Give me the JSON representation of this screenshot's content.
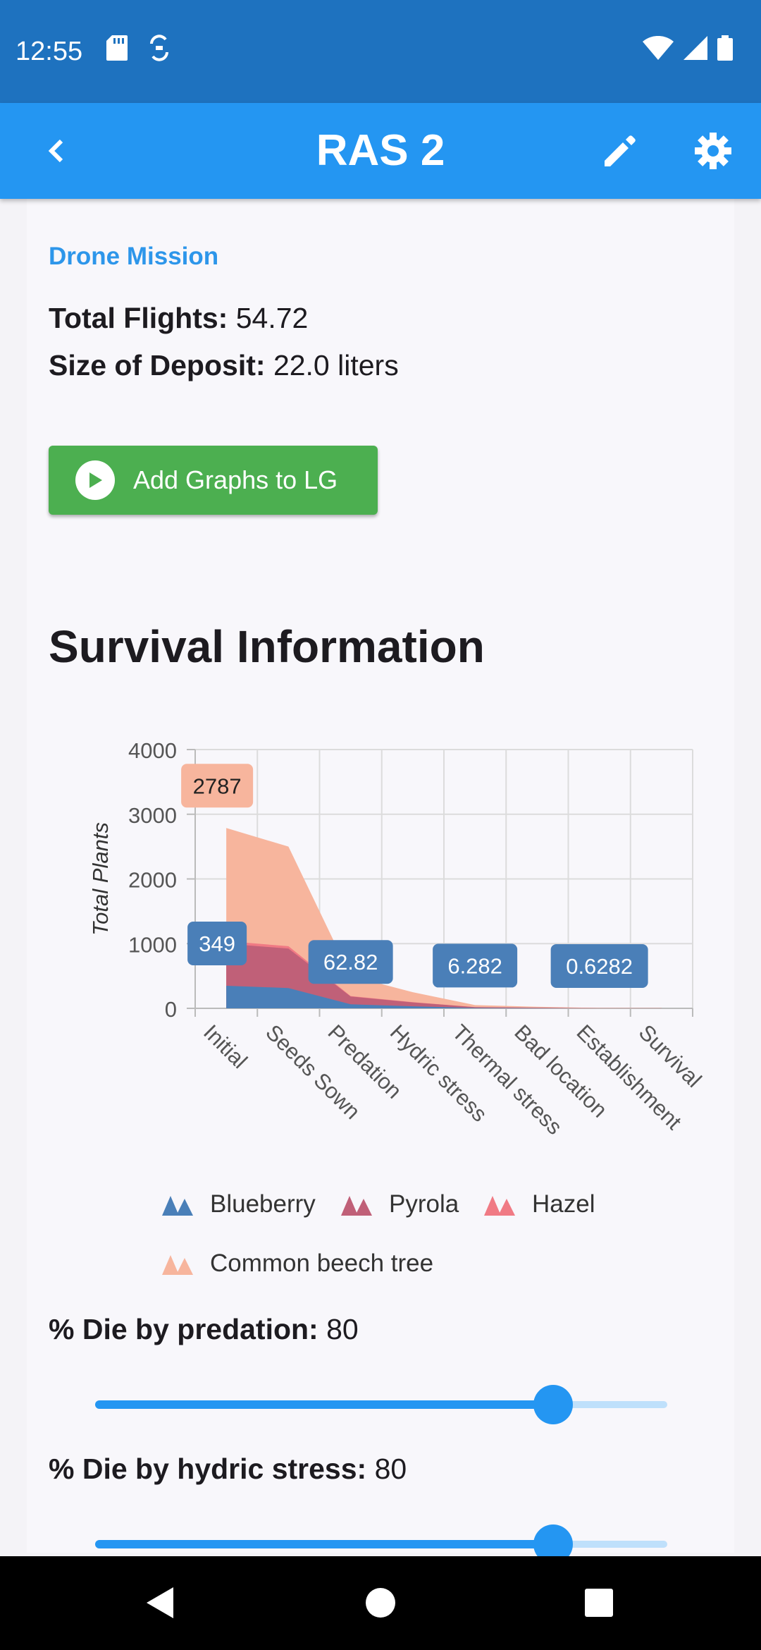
{
  "status_bar": {
    "time": "12:55",
    "icons": [
      "sd-card-icon",
      "sync-icon",
      "wifi-icon",
      "signal-icon",
      "battery-icon"
    ]
  },
  "app_bar": {
    "title": "RAS 2",
    "icons": [
      "back-chevron-icon",
      "pencil-icon",
      "gear-icon"
    ]
  },
  "drone_mission": {
    "section_label": "Drone Mission",
    "total_flights_label": "Total Flights:",
    "total_flights_value": "54.72",
    "deposit_label": "Size of Deposit:",
    "deposit_value": "22.0 liters"
  },
  "add_graphs_button": {
    "label": "Add Graphs to LG",
    "icon": "play-circle-icon"
  },
  "survival": {
    "heading": "Survival Information"
  },
  "chart_data": {
    "type": "area",
    "stacked": true,
    "ylabel": "Total Plants",
    "xlabel": "",
    "ylim": [
      0,
      4000
    ],
    "yticks": [
      "4000",
      "3000",
      "2000",
      "1000",
      "0"
    ],
    "categories": [
      "Initial",
      "Seeds Sown",
      "Predation",
      "Hydric stress",
      "Thermal stress",
      "Bad location",
      "Establishment",
      "Survival"
    ],
    "grid": true,
    "series": [
      {
        "name": "Blueberry",
        "color": "#4a7fb8",
        "values": [
          349,
          314,
          62.82,
          31.4,
          6.282,
          3.1,
          0.6282,
          0.3
        ]
      },
      {
        "name": "Pyrola",
        "color": "#c06078",
        "values": [
          650,
          610,
          120,
          60,
          12,
          6,
          1.2,
          0.6
        ]
      },
      {
        "name": "Hazel",
        "color": "#f07a84",
        "values": [
          40,
          36,
          7,
          3.5,
          0.7,
          0.35,
          0.07,
          0.04
        ]
      },
      {
        "name": "Common beech tree",
        "color": "#f7b59d",
        "values": [
          1748,
          1540,
          310,
          155,
          31,
          15.5,
          3.1,
          1.5
        ]
      }
    ],
    "data_labels": [
      {
        "text": "2787",
        "series": "Common beech tree",
        "category": "Initial",
        "value": 2787
      },
      {
        "text": "349",
        "series": "Blueberry",
        "category": "Initial",
        "value": 349
      },
      {
        "text": "62.82",
        "series": "Blueberry",
        "category": "Predation",
        "value": 62.82
      },
      {
        "text": "6.282",
        "series": "Blueberry",
        "category": "Thermal stress",
        "value": 6.282
      },
      {
        "text": "0.6282",
        "series": "Blueberry",
        "category": "Establishment",
        "value": 0.6282
      }
    ],
    "legend": [
      "Blueberry",
      "Pyrola",
      "Hazel",
      "Common beech tree"
    ],
    "legend_placement": "bottom"
  },
  "sliders": [
    {
      "label": "% Die by predation:",
      "value": "80",
      "fraction": 0.8
    },
    {
      "label": "% Die by hydric stress:",
      "value": "80",
      "fraction": 0.8
    }
  ],
  "nav_bar": {
    "icons": [
      "back-triangle-icon",
      "home-circle-icon",
      "recents-square-icon"
    ]
  }
}
